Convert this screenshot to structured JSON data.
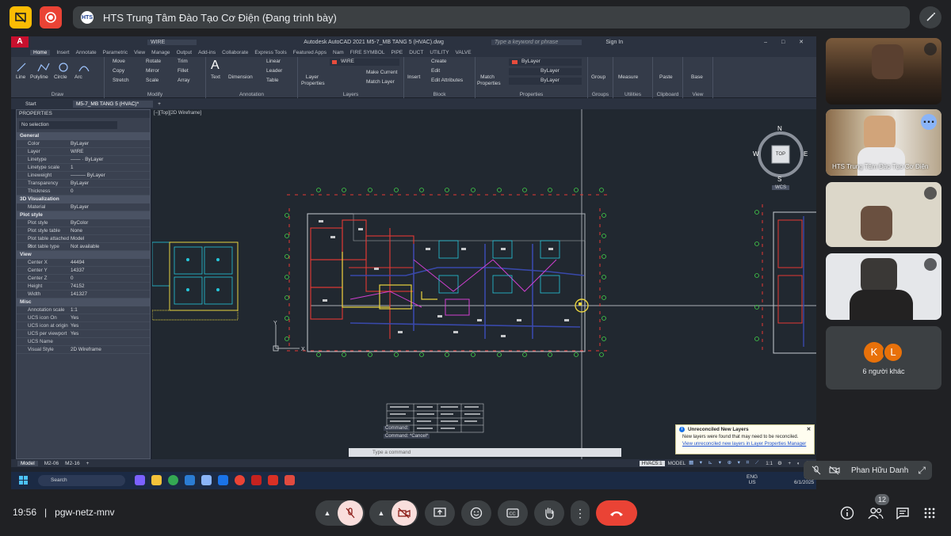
{
  "meeting": {
    "presenter_title": "HTS Trung Tâm Đào Tạo Cơ Điện (Đang trình bày)",
    "logo_text": "HTS",
    "time": "19:56",
    "separator": "|",
    "meeting_code": "pgw-netz-mnv",
    "participant_count": "12"
  },
  "autocad": {
    "title": "Autodesk AutoCAD 2021    M5-7_MB TANG 5 (HVAC).dwg",
    "search_placeholder": "Type a keyword or phrase",
    "sign_in": "Sign In",
    "layer_quick": "WIRE",
    "ribbon_tabs": [
      "Home",
      "Insert",
      "Annotate",
      "Parametric",
      "View",
      "Manage",
      "Output",
      "Add-ins",
      "Collaborate",
      "Express Tools",
      "Featured Apps",
      "Nam",
      "FIRE SYMBOL",
      "PIPE",
      "DUCT",
      "UTILITY",
      "VALVE"
    ],
    "draw": {
      "line": "Line",
      "polyline": "Polyline",
      "circle": "Circle",
      "arc": "Arc",
      "title": "Draw"
    },
    "modify": {
      "move": "Move",
      "rotate": "Rotate",
      "trim": "Trim",
      "copy": "Copy",
      "mirror": "Mirror",
      "fillet": "Fillet",
      "stretch": "Stretch",
      "scale": "Scale",
      "array": "Array",
      "title": "Modify"
    },
    "annotation": {
      "text": "Text",
      "dimension": "Dimension",
      "linear": "Linear",
      "leader": "Leader",
      "table": "Table",
      "title": "Annotation"
    },
    "layers": {
      "layer_properties": "Layer Properties",
      "current_layer": "WIRE",
      "make_current": "Make Current",
      "match_layer": "Match Layer",
      "title": "Layers"
    },
    "block": {
      "insert": "Insert",
      "create": "Create",
      "edit": "Edit",
      "edit_attributes": "Edit Attributes",
      "title": "Block"
    },
    "properties_panel": {
      "match": "Match Properties",
      "color": "ByLayer",
      "linetype": "ByLayer",
      "lineweight": "ByLayer",
      "title": "Properties"
    },
    "groups": {
      "group": "Group",
      "title": "Groups"
    },
    "utilities": {
      "measure": "Measure",
      "title": "Utilities"
    },
    "clipboard": {
      "paste": "Paste",
      "title": "Clipboard"
    },
    "view": {
      "base": "Base",
      "title": "View"
    },
    "doc_tabs": [
      "Start",
      "M5-7_MB TANG 5 (HVAC)*"
    ],
    "viewport_label": "[−][Top][2D Wireframe]",
    "viewcube": {
      "top": "TOP",
      "n": "N",
      "s": "S",
      "e": "E",
      "w": "W",
      "wcs": "WCS"
    },
    "palette_title": "PROPERTIES",
    "selection": "No selection",
    "sections": [
      {
        "name": "General",
        "rows": [
          [
            "Color",
            "ByLayer"
          ],
          [
            "Layer",
            "WIRE"
          ],
          [
            "Linetype",
            "—— · ByLayer"
          ],
          [
            "Linetype scale",
            "1"
          ],
          [
            "Lineweight",
            "——— ByLayer"
          ],
          [
            "Transparency",
            "ByLayer"
          ],
          [
            "Thickness",
            "0"
          ]
        ]
      },
      {
        "name": "3D Visualization",
        "rows": [
          [
            "Material",
            "ByLayer"
          ]
        ]
      },
      {
        "name": "Plot style",
        "rows": [
          [
            "Plot style",
            "ByColor"
          ],
          [
            "Plot style table",
            "None"
          ],
          [
            "Plot table attached to",
            "Model"
          ],
          [
            "Plot table type",
            "Not available"
          ]
        ]
      },
      {
        "name": "View",
        "rows": [
          [
            "Center X",
            "44494"
          ],
          [
            "Center Y",
            "14337"
          ],
          [
            "Center Z",
            "0"
          ],
          [
            "Height",
            "74152"
          ],
          [
            "Width",
            "141327"
          ]
        ]
      },
      {
        "name": "Misc",
        "rows": [
          [
            "Annotation scale",
            "1:1"
          ],
          [
            "UCS icon On",
            "Yes"
          ],
          [
            "UCS icon at origin",
            "Yes"
          ],
          [
            "UCS per viewport",
            "Yes"
          ],
          [
            "UCS Name",
            ""
          ],
          [
            "Visual Style",
            "2D Wireframe"
          ]
        ]
      }
    ],
    "command_history": [
      "Command:",
      "Command: *Cancel*"
    ],
    "command_placeholder": "Type a command",
    "layout_tabs": [
      "Model",
      "M2-06",
      "M2-16"
    ],
    "status": {
      "model_label": "HVAC5:1",
      "model": "MODEL",
      "scale": "1:1"
    },
    "notification": {
      "title": "Unreconciled New Layers",
      "body": "New layers were found that may need to be reconciled.",
      "link": "View unreconciled new layers in Layer Properties Manager"
    },
    "taskbar": {
      "search": "Search",
      "lang": "ENG",
      "region": "US",
      "time": "19:5",
      "date": "6/1/2025"
    }
  },
  "participants": {
    "others_label": "6 người khác",
    "others_initials": [
      "K",
      "L"
    ],
    "self_name": "Phan Hữu Danh",
    "tile_caption": "HTS Trung Tâm Đào Tạo Cơ Điện"
  },
  "colors": {
    "accent": "#ea4335",
    "avatar_k": "#e8710a",
    "avatar_l": "#e8710a"
  }
}
